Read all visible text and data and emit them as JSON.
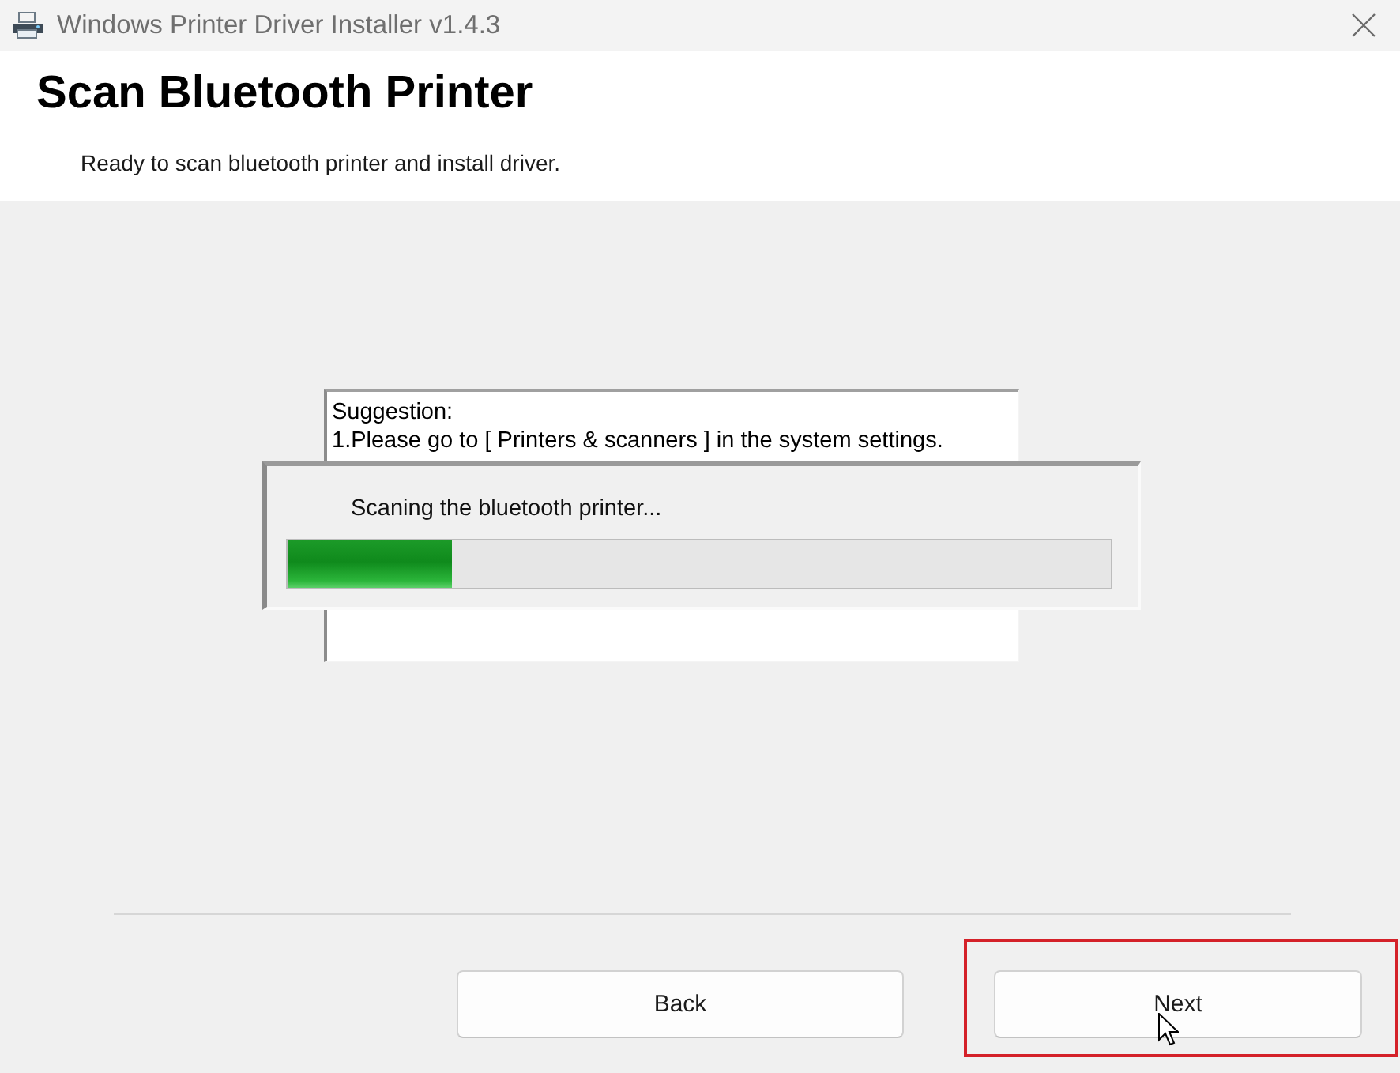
{
  "window": {
    "title": "Windows Printer Driver Installer v1.4.3"
  },
  "header": {
    "title": "Scan Bluetooth Printer",
    "subtitle": "Ready to scan bluetooth printer and install driver."
  },
  "suggestion_box": {
    "lines": [
      "Suggestion:",
      "1.Please go to [ Printers & scanners ] in the system settings."
    ]
  },
  "progress_dialog": {
    "message": "Scaning the bluetooth printer...",
    "level": 0.2
  },
  "buttons": [
    {
      "label": "Back",
      "highlighted": false,
      "pointer": false
    },
    {
      "label": "Next",
      "highlighted": true,
      "pointer": true
    }
  ]
}
